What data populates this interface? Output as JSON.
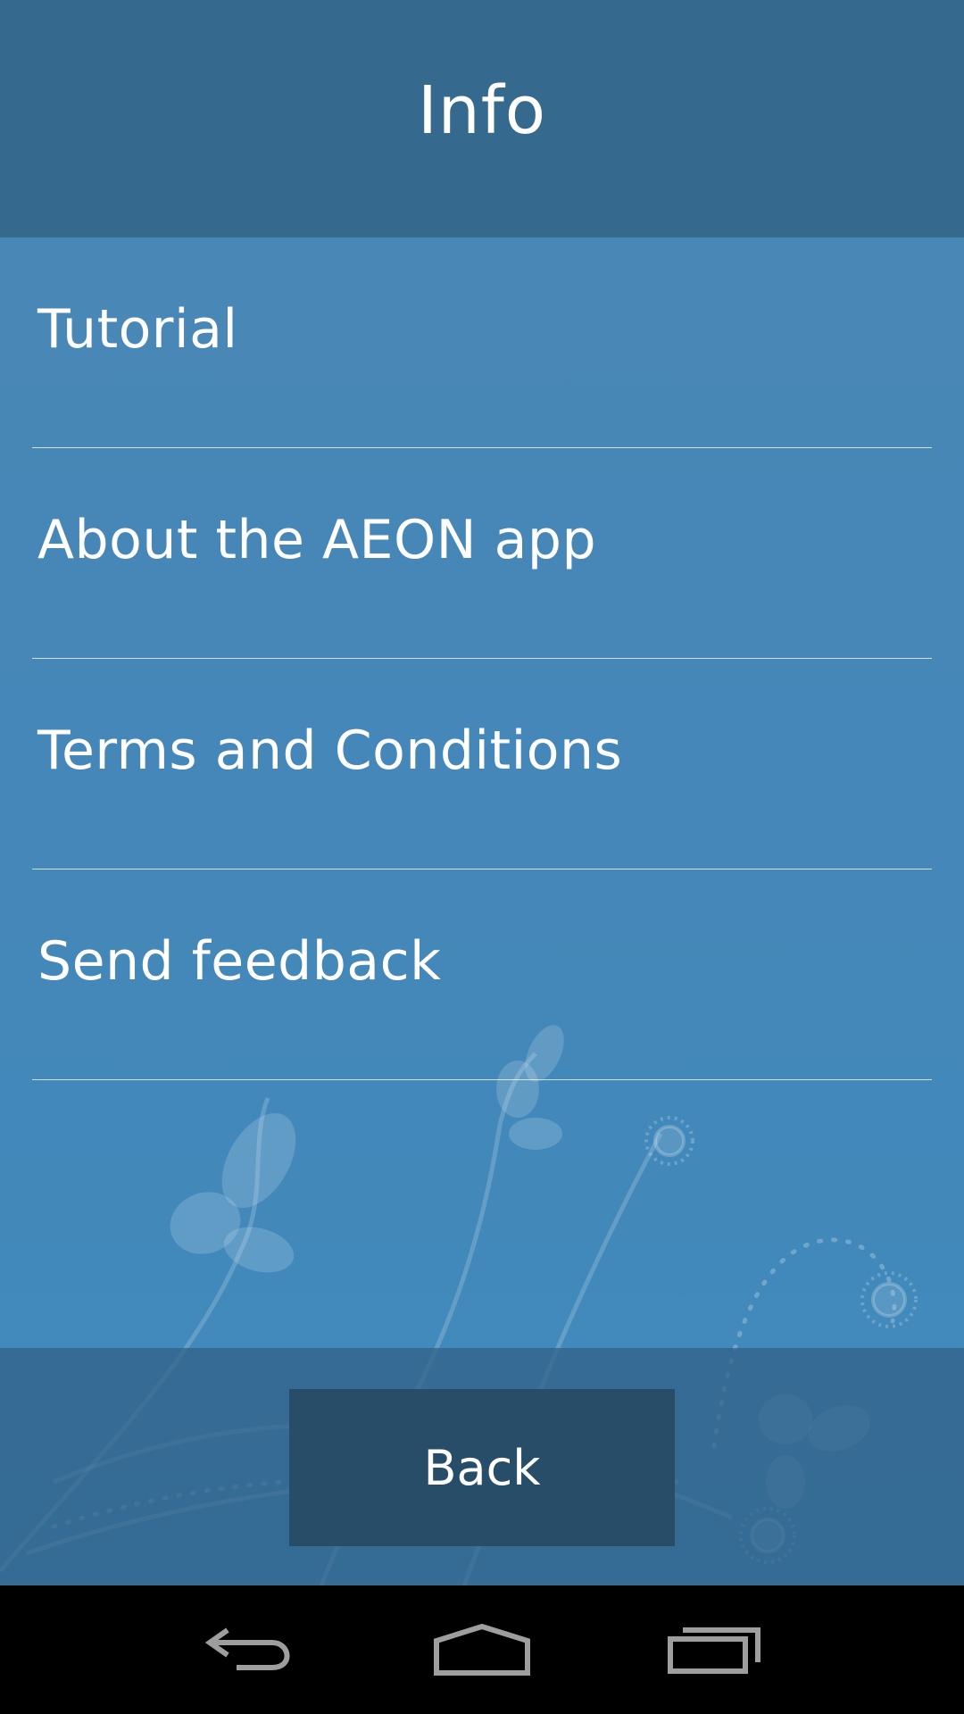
{
  "header": {
    "title": "Info"
  },
  "menu": {
    "items": [
      {
        "label": "Tutorial"
      },
      {
        "label": "About the AEON app"
      },
      {
        "label": "Terms and Conditions"
      },
      {
        "label": "Send feedback"
      }
    ]
  },
  "footer": {
    "back_label": "Back"
  },
  "navbar": {
    "icons": [
      "back-arrow-icon",
      "home-icon",
      "recent-apps-icon"
    ]
  },
  "colors": {
    "header_bg": "#356a8e",
    "content_bg": "#4487b8",
    "button_bg": "#274d68",
    "text": "#ffffff"
  }
}
